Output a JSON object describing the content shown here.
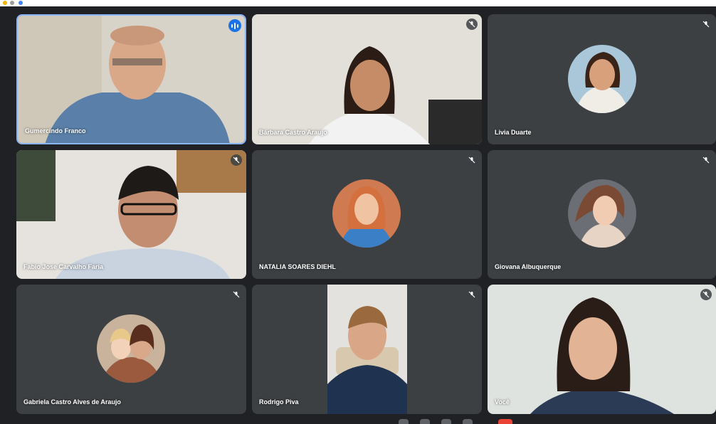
{
  "participants": [
    {
      "name": "Gumercindo Franco",
      "speaking": true
    },
    {
      "name": "Bárbara Castro Araujo",
      "muted": true
    },
    {
      "name": "Livia Duarte",
      "muted": true
    },
    {
      "name": "Fabio Jose Carvalho Faria",
      "muted": true
    },
    {
      "name": "NATALIA SOARES DIEHL",
      "muted": true
    },
    {
      "name": "Giovana Albuquerque",
      "muted": true
    },
    {
      "name": "Gabriela Castro Alves de Araujo",
      "muted": true
    },
    {
      "name": "Rodrigo Piva",
      "muted": true
    },
    {
      "name": "Você",
      "muted": true
    }
  ],
  "icons": {
    "muted": "mic-off-icon",
    "speaking": "audio-levels-icon"
  },
  "colors": {
    "background": "#202124",
    "tile": "#3c4043",
    "active_border": "#8ab4f8",
    "accent": "#1a73e8",
    "end_call": "#ea4335"
  }
}
